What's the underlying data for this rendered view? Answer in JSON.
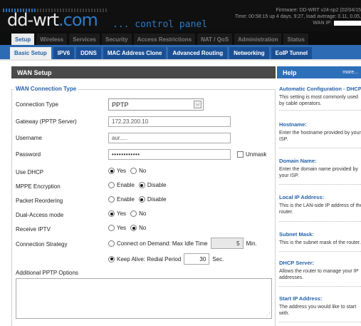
{
  "header": {
    "logo_main": "dd-wrt",
    "logo_com": ".com",
    "control_panel": "... control panel",
    "firmware_line": "Firmware: DD-WRT v24-sp2 (02/04/15",
    "time_line": "Time: 00:58:15 up 4 days, 9:27, load average: 0.11, 0.05,",
    "wan_ip_label": "WAN IP:"
  },
  "main_tabs": [
    "Setup",
    "Wireless",
    "Services",
    "Security",
    "Access Restrictions",
    "NAT / QoS",
    "Administration",
    "Status"
  ],
  "sub_tabs": [
    "Basic Setup",
    "IPV6",
    "DDNS",
    "MAC Address Clone",
    "Advanced Routing",
    "Networking",
    "EoIP Tunnel"
  ],
  "section": {
    "title": "WAN Setup",
    "legend": "WAN Connection Type"
  },
  "help": {
    "title": "Help",
    "more": "more...",
    "items": [
      {
        "heading": "Automatic Configuration - DHCP",
        "text": "This setting is most commonly used by cable operators."
      },
      {
        "heading": "Hostname:",
        "text": "Enter the hostname provided by your ISP."
      },
      {
        "heading": "Domain Name:",
        "text": "Enter the domain name provided by your ISP."
      },
      {
        "heading": "Local IP Address:",
        "text": "This is the LAN-side IP address of the router."
      },
      {
        "heading": "Subnet Mask:",
        "text": "This is the subnet mask of the router."
      },
      {
        "heading": "DHCP Server:",
        "text": "Allows the router to manage your IP addresses."
      },
      {
        "heading": "Start IP Address:",
        "text": "The address you would like to start with."
      }
    ]
  },
  "form": {
    "connection_type_label": "Connection Type",
    "connection_type_value": "PPTP",
    "gateway_label": "Gateway (PPTP Server)",
    "gateway_value": "172.23.200.10",
    "username_label": "Username",
    "username_value": "aur.....",
    "password_label": "Password",
    "password_value": "••••••••••••",
    "unmask_label": "Unmask",
    "use_dhcp_label": "Use DHCP",
    "mppe_label": "MPPE Encryption",
    "packet_reordering_label": "Packet Reordering",
    "dual_access_label": "Dual-Access mode",
    "receive_iptv_label": "Receive IPTV",
    "connection_strategy_label": "Connection Strategy",
    "yes": "Yes",
    "no": "No",
    "enable": "Enable",
    "disable": "Disable",
    "connect_on_demand_label": "Connect on Demand: Max Idle Time",
    "max_idle_value": "5",
    "max_idle_unit": "Min.",
    "keep_alive_label": "Keep Alive: Redial Period",
    "redial_value": "30",
    "redial_unit": "Sec.",
    "additional_options_label": "Additional PPTP Options"
  }
}
